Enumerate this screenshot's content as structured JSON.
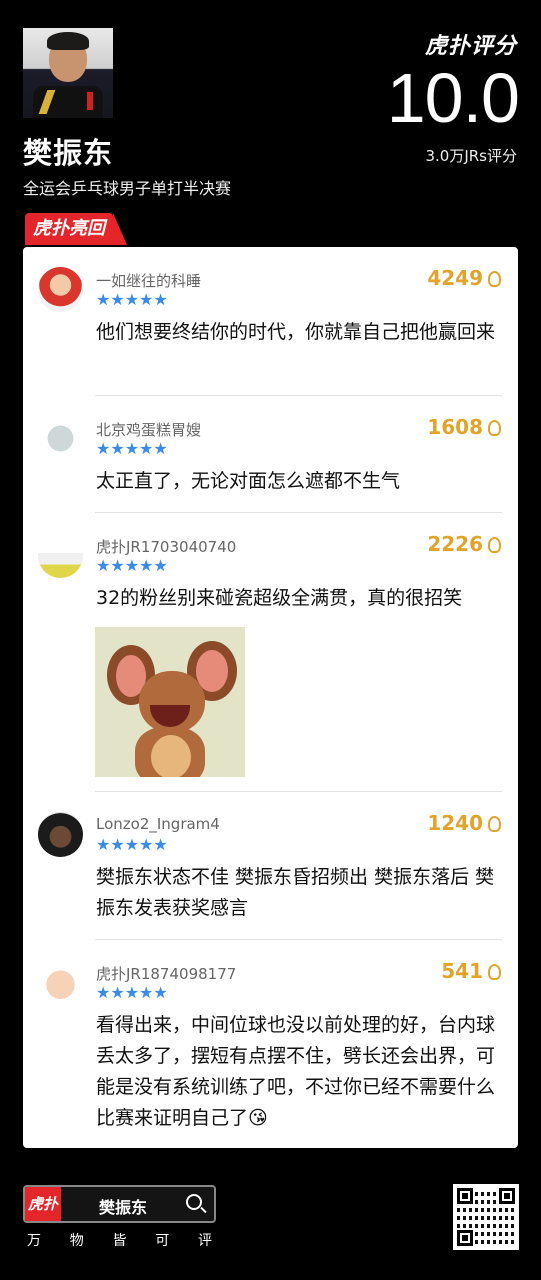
{
  "header": {
    "player_name": "樊振东",
    "event": "全运会乒乓球男子单打半决赛",
    "brand": "虎扑评分",
    "score": "10.0",
    "rating_count": "3.0万JRs评分"
  },
  "section_badge": "虎扑亮回复",
  "comments": [
    {
      "user": "一如继往的科睡",
      "stars": "★★★★★",
      "likes": "4249",
      "text": "他们想要终结你的时代，你就靠自己把他赢回来"
    },
    {
      "user": "北京鸡蛋糕胃嫂",
      "stars": "★★★★★",
      "likes": "1608",
      "text": "太正直了，无论对面怎么遮都不生气"
    },
    {
      "user": "虎扑JR1703040740",
      "stars": "★★★★★",
      "likes": "2226",
      "text": "32的粉丝别来碰瓷超级全满贯，真的很招笑"
    },
    {
      "user": "Lonzo2_Ingram4",
      "stars": "★★★★★",
      "likes": "1240",
      "text": "樊振东状态不佳 樊振东昏招频出 樊振东落后 樊振东发表获奖感言"
    },
    {
      "user": "虎扑JR1874098177",
      "stars": "★★★★★",
      "likes": "541",
      "text": "看得出来，中间位球也没以前处理的好，台内球丢太多了，摆短有点摆不住，劈长还会出界，可能是没有系统训练了吧，不过你已经不需要什么比赛来证明自己了😘"
    }
  ],
  "footer": {
    "app_icon_text": "虎扑",
    "search_query": "樊振东",
    "slogan": [
      "万",
      "物",
      "皆",
      "可",
      "评"
    ]
  },
  "colors": {
    "accent_red": "#e4262b",
    "likes_gold": "#e2a32a",
    "stars_blue": "#3a8be8"
  }
}
